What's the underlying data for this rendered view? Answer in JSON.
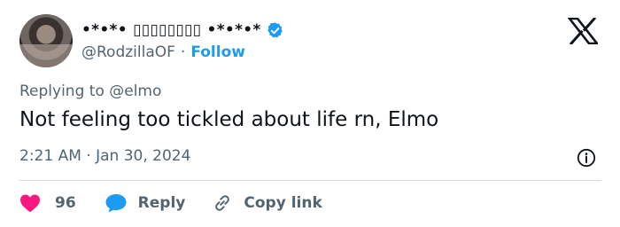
{
  "author": {
    "display_name": "•*•*• ▯▯▯▯▯▯▯▯ •*•*•*",
    "handle": "@RodzillaOF",
    "separator": "·",
    "follow_label": "Follow"
  },
  "tweet": {
    "replying_to": "Replying to @elmo",
    "text": "Not feeling too tickled about life rn, Elmo",
    "timestamp": "2:21 AM · Jan 30, 2024"
  },
  "actions": {
    "like_count": "96",
    "reply_label": "Reply",
    "copy_link_label": "Copy link"
  },
  "colors": {
    "accent": "#1d9bf0",
    "like": "#f91880",
    "muted": "#536471",
    "text": "#0f1419"
  },
  "icons": {
    "verified": "verified-badge-icon",
    "brand": "x-logo-icon",
    "info": "info-icon",
    "like": "heart-icon",
    "reply": "reply-bubble-icon",
    "copy": "link-icon"
  }
}
